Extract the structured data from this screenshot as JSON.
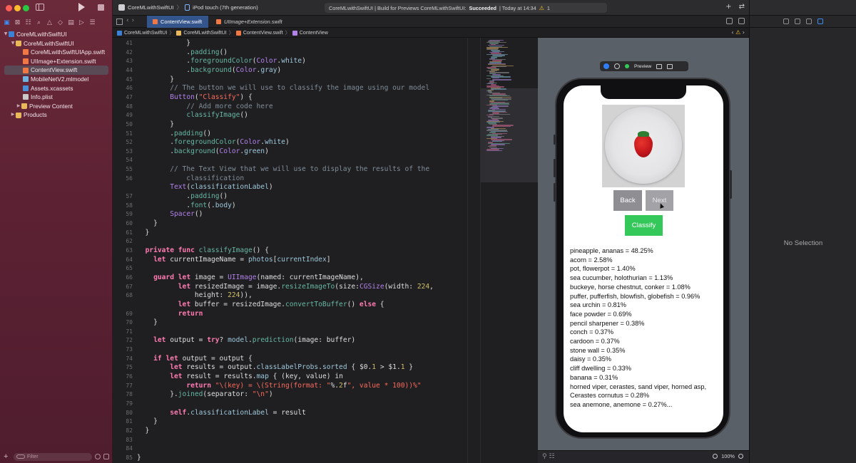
{
  "window": {
    "scheme": "CoreMLwithSwiftUI",
    "destination": "iPod touch (7th generation)",
    "status": {
      "prefix": "CoreMLwithSwiftUI | Build for Previews CoreMLwithSwiftUI: ",
      "result": "Succeeded",
      "time": "| Today at 14:34",
      "warnings": "1"
    }
  },
  "navigator": {
    "items": [
      {
        "label": "CoreMLwithSwiftUI",
        "kind": "proj"
      },
      {
        "label": "CoreMLwithSwiftUI",
        "kind": "folder"
      },
      {
        "label": "CoreMLwithSwiftUIApp.swift",
        "kind": "swift"
      },
      {
        "label": "UIImage+Extension.swift",
        "kind": "swift"
      },
      {
        "label": "ContentView.swift",
        "kind": "swift",
        "selected": true
      },
      {
        "label": "MobileNetV2.mlmodel",
        "kind": "ml"
      },
      {
        "label": "Assets.xcassets",
        "kind": "assets"
      },
      {
        "label": "Info.plist",
        "kind": "plist"
      },
      {
        "label": "Preview Content",
        "kind": "folder"
      },
      {
        "label": "Products",
        "kind": "folder"
      }
    ],
    "filter_placeholder": "Filter"
  },
  "tabs": {
    "active": "ContentView.swift",
    "inactive": "UIImage+Extension.swift"
  },
  "breadcrumb": [
    "CoreMLwithSwiftUI",
    "CoreMLwithSwiftUI",
    "ContentView.swift",
    "ContentView"
  ],
  "editor": {
    "line_numbers": [
      "41",
      "42",
      "43",
      "44",
      "45",
      "46",
      "47",
      "48",
      "49",
      "50",
      "51",
      "52",
      "53",
      "54",
      "55",
      "56",
      "",
      "57",
      "58",
      "59",
      "60",
      "61",
      "62",
      "63",
      "64",
      "65",
      "66",
      "67",
      "68",
      "",
      "69",
      "70",
      "71",
      "72",
      "73",
      "74",
      "75",
      "76",
      "77",
      "78",
      "79",
      "80",
      "81",
      "82",
      "83",
      "84",
      "85"
    ],
    "lines": [
      "            }",
      "            .padding()",
      "            .foregroundColor(Color.white)",
      "            .background(Color.gray)",
      "        }",
      "        // The button we will use to classify the image using our model",
      "        Button(\"Classify\") {",
      "            // Add more code here",
      "            classifyImage()",
      "        }",
      "        .padding()",
      "        .foregroundColor(Color.white)",
      "        .background(Color.green)",
      "",
      "        // The Text View that we will use to display the results of the",
      "            classification",
      "        Text(classificationLabel)",
      "            .padding()",
      "            .font(.body)",
      "        Spacer()",
      "    }",
      "  }",
      "",
      "  private func classifyImage() {",
      "    let currentImageName = photos[currentIndex]",
      "",
      "    guard let image = UIImage(named: currentImageName),",
      "          let resizedImage = image.resizeImageTo(size:CGSize(width: 224,",
      "              height: 224)),",
      "          let buffer = resizedImage.convertToBuffer() else {",
      "          return",
      "    }",
      "",
      "    let output = try? model.prediction(image: buffer)",
      "",
      "    if let output = output {",
      "        let results = output.classLabelProbs.sorted { $0.1 > $1.1 }",
      "        let result = results.map { (key, value) in",
      "            return \"\\(key) = \\(String(format: \"%.2f\", value * 100))%\"",
      "        }.joined(separator: \"\\n\")",
      "",
      "        self.classificationLabel = result",
      "    }",
      "  }",
      "",
      "",
      "}"
    ]
  },
  "preview": {
    "label": "Preview",
    "buttons": {
      "back": "Back",
      "next": "Next",
      "classify": "Classify"
    },
    "results": [
      "pineapple, ananas = 48.25%",
      "acorn = 2.58%",
      "pot, flowerpot = 1.40%",
      "sea cucumber, holothurian = 1.13%",
      "buckeye, horse chestnut, conker = 1.08%",
      "puffer, pufferfish, blowfish, globefish = 0.96%",
      "sea urchin = 0.81%",
      "face powder = 0.69%",
      "pencil sharpener = 0.38%",
      "conch = 0.37%",
      "cardoon = 0.37%",
      "stone wall = 0.35%",
      "daisy = 0.35%",
      "cliff dwelling = 0.33%",
      "banana = 0.31%",
      "horned viper, cerastes, sand viper, horned asp,",
      "Cerastes cornutus = 0.28%",
      "sea anemone, anemone = 0.27%..."
    ],
    "zoom": "100%"
  },
  "inspector": {
    "empty_label": "No Selection"
  }
}
